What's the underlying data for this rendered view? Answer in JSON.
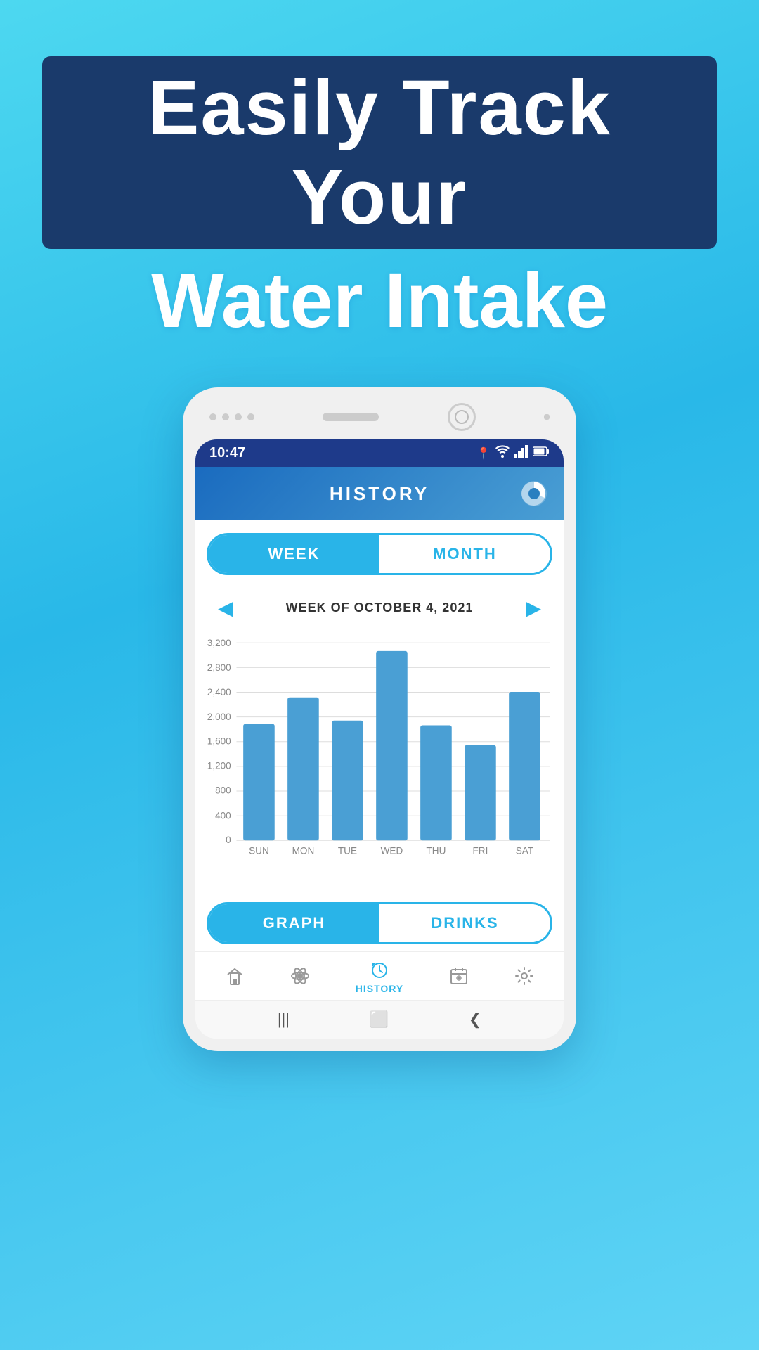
{
  "background": {
    "gradient_start": "#4dd8f0",
    "gradient_end": "#29b8e8"
  },
  "header": {
    "line1": "Easily Track Your",
    "line2": "Water Intake",
    "line1_bg": "#1a3a6b"
  },
  "status_bar": {
    "time": "10:47",
    "location_icon": "📍",
    "wifi_icon": "wifi",
    "signal_icon": "signal",
    "battery_icon": "battery"
  },
  "app_header": {
    "title": "HISTORY",
    "icon": "pie-chart"
  },
  "week_month_toggle": {
    "week_label": "WEEK",
    "month_label": "MONTH",
    "active": "week"
  },
  "week_nav": {
    "prev_arrow": "◀",
    "next_arrow": "▶",
    "label": "WEEK OF OCTOBER 4, 2021"
  },
  "chart": {
    "y_labels": [
      "0",
      "400",
      "800",
      "1,200",
      "1,600",
      "2,000",
      "2,400",
      "2,800",
      "3,200"
    ],
    "bars": [
      {
        "day": "SUN",
        "value": 1880
      },
      {
        "day": "MON",
        "value": 2320
      },
      {
        "day": "TUE",
        "value": 1940
      },
      {
        "day": "WED",
        "value": 3060
      },
      {
        "day": "THU",
        "value": 1860
      },
      {
        "day": "FRI",
        "value": 1540
      },
      {
        "day": "SAT",
        "value": 2400
      }
    ],
    "max_value": 3200,
    "bar_color": "#4a9fd4"
  },
  "graph_drinks_toggle": {
    "graph_label": "GRAPH",
    "drinks_label": "DRINKS",
    "active": "graph"
  },
  "bottom_nav": {
    "items": [
      {
        "icon": "glass",
        "label": "",
        "active": false
      },
      {
        "icon": "atom",
        "label": "",
        "active": false
      },
      {
        "icon": "history",
        "label": "HISTORY",
        "active": true
      },
      {
        "icon": "calendar",
        "label": "",
        "active": false
      },
      {
        "icon": "settings",
        "label": "",
        "active": false
      }
    ]
  },
  "android_nav": {
    "back": "❮",
    "home": "⬜",
    "recents": "|||"
  }
}
